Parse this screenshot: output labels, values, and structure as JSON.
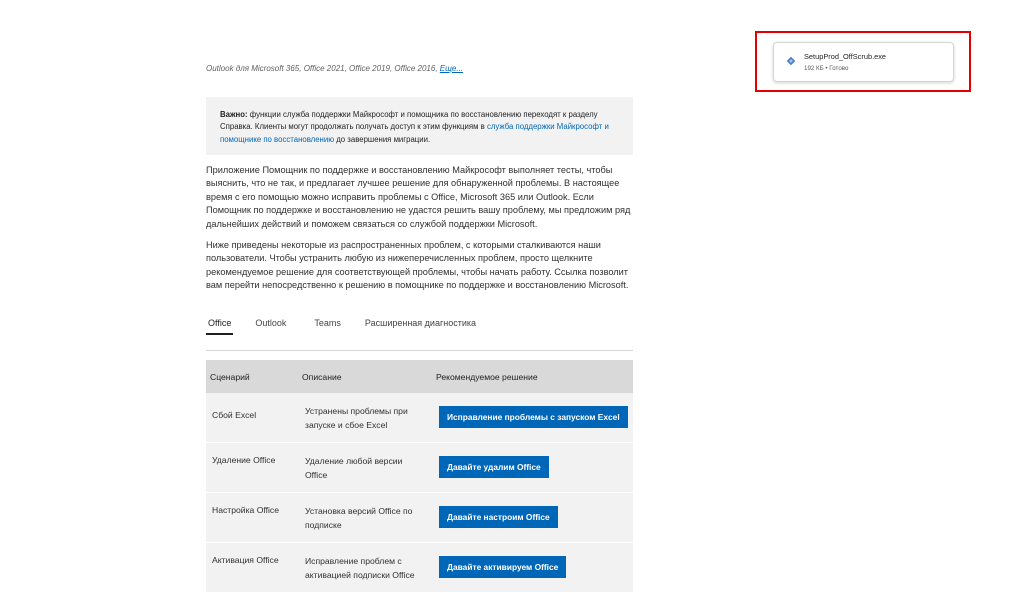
{
  "applies_to": {
    "text": "Outlook для Microsoft 365, Office 2021, Office 2019, Office 2016, ",
    "more_link": "Еще..."
  },
  "alert": {
    "bold": "Важно:",
    "text1": " функции служба поддержки Майкрософт и помощника по восстановлению переходят к разделу Справка. Клиенты могут продолжать получать доступ к этим функциям в ",
    "link": "служба поддержки Майкрософт и помощнике по восстановлению",
    "text2": " до завершения миграции."
  },
  "paragraphs": [
    "Приложение Помощник по поддержке и восстановлению Майкрософт выполняет тесты, чтобы выяснить, что не так, и предлагает лучшее решение для обнаруженной проблемы. В настоящее время с его помощью можно исправить проблемы с Office, Microsoft 365 или Outlook. Если Помощник по поддержке и восстановлению не удастся решить вашу проблему, мы предложим ряд дальнейших действий и поможем связаться со службой поддержки Microsoft.",
    "Ниже приведены некоторые из распространенных проблем, с которыми сталкиваются наши пользователи. Чтобы устранить любую из нижеперечисленных проблем, просто щелкните рекомендуемое решение для соответствующей проблемы, чтобы начать работу. Ссылка позволит вам перейти непосредственно к решению в помощнике по поддержке и восстановлению Microsoft."
  ],
  "tabs": [
    "Office",
    "Outlook",
    "Teams",
    "Расширенная диагностика"
  ],
  "table": {
    "headers": [
      "Сценарий",
      "Описание",
      "Рекомендуемое решение"
    ],
    "rows": [
      {
        "scenario": "Сбой Excel",
        "description": "Устранены проблемы при запуске и сбое Excel",
        "action": "Исправление проблемы с запуском Excel"
      },
      {
        "scenario": "Удаление Office",
        "description": "Удаление любой версии Office",
        "action": "Давайте удалим Office"
      },
      {
        "scenario": "Настройка Office",
        "description": "Установка версий Office по подписке",
        "action": "Давайте настроим Office"
      },
      {
        "scenario": "Активация Office",
        "description": "Исправление проблем с активацией подписки Office",
        "action": "Давайте активируем Office"
      }
    ]
  },
  "download": {
    "filename": "SetupProd_OffScrub.exe",
    "status": "192 КБ • Готово",
    "icon": "file-installer-icon",
    "highlight_color": "#e60000"
  },
  "colors": {
    "accent": "#0067b8",
    "table_header": "#d9d9d9",
    "row_bg": "#f2f2f2"
  }
}
